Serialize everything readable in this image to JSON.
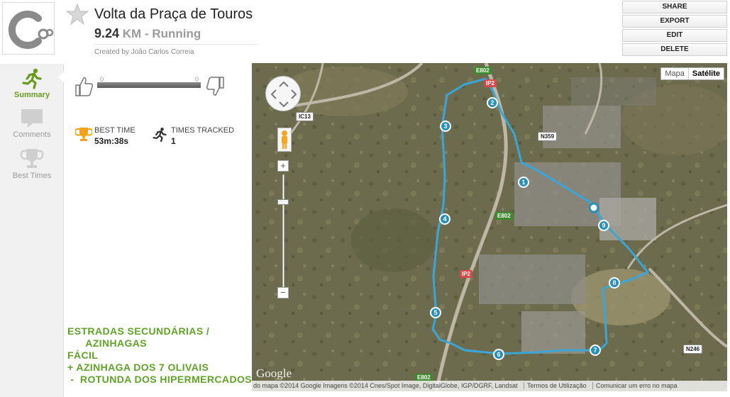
{
  "header": {
    "title": "Volta da Praça de Touros",
    "distance_value": "9.24",
    "distance_unit": "KM",
    "activity": "- Running",
    "created_by": "Created by João Carlos Correia"
  },
  "actions": [
    "SHARE",
    "EXPORT",
    "EDIT",
    "DELETE"
  ],
  "nav": {
    "summary": "Summary",
    "comments": "Comments",
    "best_times": "Best Times"
  },
  "votes": {
    "up": "0",
    "down": "0"
  },
  "stats": {
    "best_time_label": "BEST TIME",
    "best_time_value": "53m:38s",
    "times_tracked_label": "TIMES TRACKED",
    "times_tracked_value": "1"
  },
  "notes": "ESTRADAS SECUNDÁRIAS /\n      AZINHAGAS\nFÁCIL\n+ AZINHAGA DOS 7 OLIVAIS\n -  ROTUNDA DOS HIPERMERCADOS",
  "map": {
    "type_map": "Mapa",
    "type_satellite": "Satélite",
    "google": "Google",
    "attribution": "do mapa ©2014 Google Imagens ©2014 Cnes/Spot Image, DigitalGlobe, IGP/DGRF, Landsat",
    "terms": "Termos de Utilização",
    "report": "Comunicar um erro no mapa",
    "roads": {
      "e802_top": "E802",
      "ip2_top": "IP2",
      "e802_mid": "E802",
      "ip2_mid": "IP2",
      "e802_bottom": "E802",
      "ic13": "IC13",
      "n359": "N359",
      "n246": "N246"
    },
    "markers": [
      "1",
      "2",
      "3",
      "4",
      "5",
      "6",
      "7",
      "8",
      "9"
    ],
    "route_color": "#3aa6d8"
  },
  "colors": {
    "accent": "#6a9b1e",
    "notes": "#5fa327",
    "route": "#3aa6d8"
  }
}
